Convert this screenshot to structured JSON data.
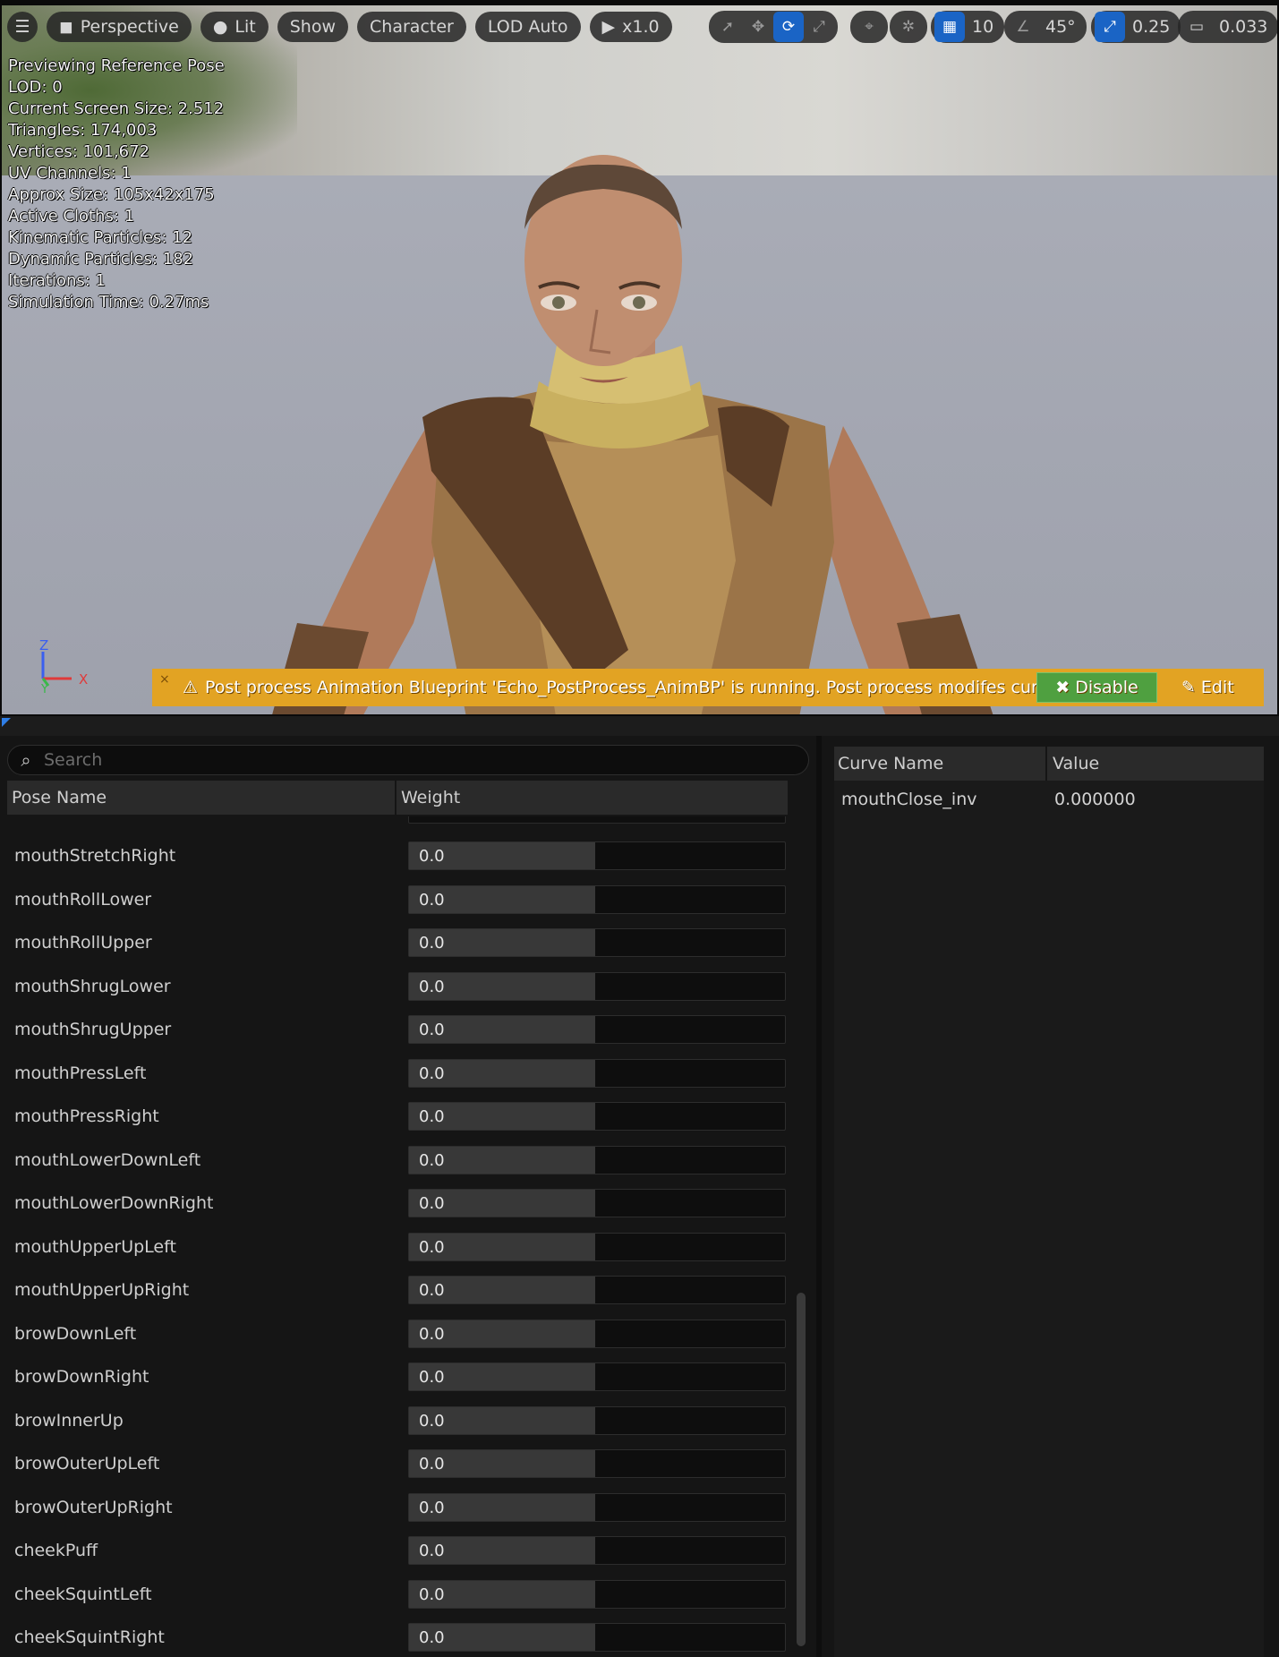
{
  "toolbar": {
    "menu_icon": "hamburger-icon",
    "perspective_label": "Perspective",
    "lit_label": "Lit",
    "show_label": "Show",
    "character_label": "Character",
    "lod_label": "LOD Auto",
    "play_speed": "x1.0",
    "grid_snap_value": "10",
    "angle_snap_value": "45°",
    "scale_snap_value": "0.25",
    "camera_speed_value": "0.033"
  },
  "stats": {
    "line1": "Previewing Reference Pose",
    "line2": "LOD: 0",
    "line3": "Current Screen Size: 2.512",
    "line4": "Triangles: 174,003",
    "line5": "Vertices: 101,672",
    "line6": "UV Channels: 1",
    "line7": "Approx Size: 105x42x175",
    "line8": "Active Cloths: 1",
    "line9": "Kinematic Particles: 12",
    "line10": "Dynamic Particles: 182",
    "line11": "Iterations: 1",
    "line12": "Simulation Time: 0.27ms"
  },
  "axes": {
    "z": "Z",
    "x": "X",
    "y": "Y"
  },
  "banner": {
    "close": "×",
    "message": "Post process Animation Blueprint 'Echo_PostProcess_AnimBP' is running. Post process modifes curves.",
    "disable_label": "Disable",
    "edit_label": "Edit",
    "color": "#e2a323"
  },
  "pose_panel": {
    "search_placeholder": "Search",
    "col_pose": "Pose Name",
    "col_weight": "Weight",
    "rows": [
      {
        "name": "mouthStretchRight",
        "weight": "0.0"
      },
      {
        "name": "mouthRollLower",
        "weight": "0.0"
      },
      {
        "name": "mouthRollUpper",
        "weight": "0.0"
      },
      {
        "name": "mouthShrugLower",
        "weight": "0.0"
      },
      {
        "name": "mouthShrugUpper",
        "weight": "0.0"
      },
      {
        "name": "mouthPressLeft",
        "weight": "0.0"
      },
      {
        "name": "mouthPressRight",
        "weight": "0.0"
      },
      {
        "name": "mouthLowerDownLeft",
        "weight": "0.0"
      },
      {
        "name": "mouthLowerDownRight",
        "weight": "0.0"
      },
      {
        "name": "mouthUpperUpLeft",
        "weight": "0.0"
      },
      {
        "name": "mouthUpperUpRight",
        "weight": "0.0"
      },
      {
        "name": "browDownLeft",
        "weight": "0.0"
      },
      {
        "name": "browDownRight",
        "weight": "0.0"
      },
      {
        "name": "browInnerUp",
        "weight": "0.0"
      },
      {
        "name": "browOuterUpLeft",
        "weight": "0.0"
      },
      {
        "name": "browOuterUpRight",
        "weight": "0.0"
      },
      {
        "name": "cheekPuff",
        "weight": "0.0"
      },
      {
        "name": "cheekSquintLeft",
        "weight": "0.0"
      },
      {
        "name": "cheekSquintRight",
        "weight": "0.0"
      }
    ]
  },
  "curve_panel": {
    "col_curve": "Curve Name",
    "col_value": "Value",
    "rows": [
      {
        "name": "mouthClose_inv",
        "value": "0.000000"
      }
    ]
  }
}
